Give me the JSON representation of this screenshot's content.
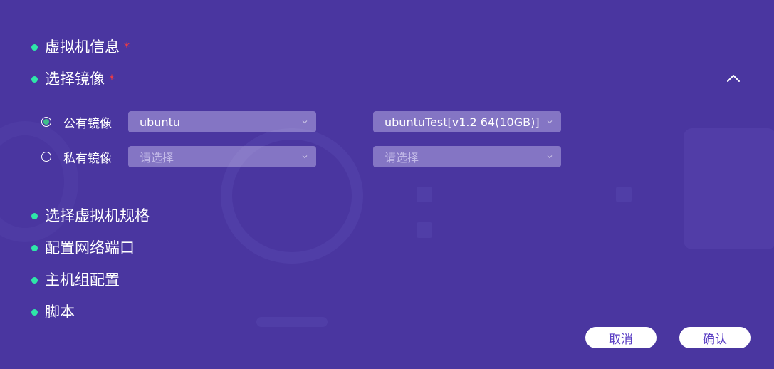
{
  "sections": {
    "vm_info": {
      "label": "虚拟机信息",
      "required_mark": "*"
    },
    "image": {
      "label": "选择镜像",
      "required_mark": "*"
    },
    "spec": {
      "label": "选择虚拟机规格"
    },
    "network": {
      "label": "配置网络端口"
    },
    "host_group": {
      "label": "主机组配置"
    },
    "script": {
      "label": "脚本"
    }
  },
  "image_options": {
    "public": {
      "label": "公有镜像",
      "selected": true,
      "os_value": "ubuntu",
      "version_value": "ubuntuTest[v1.2 64(10GB)]"
    },
    "private": {
      "label": "私有镜像",
      "selected": false,
      "os_placeholder": "请选择",
      "version_placeholder": "请选择"
    }
  },
  "buttons": {
    "cancel": "取消",
    "confirm": "确认"
  },
  "colors": {
    "background": "#4a36a0",
    "bullet": "#2ee6a8",
    "required": "#ff3b3b",
    "button_text": "#5b3fc4"
  },
  "icons": {
    "collapse": "chevron-up-icon",
    "dropdown": "chevron-down-icon"
  }
}
